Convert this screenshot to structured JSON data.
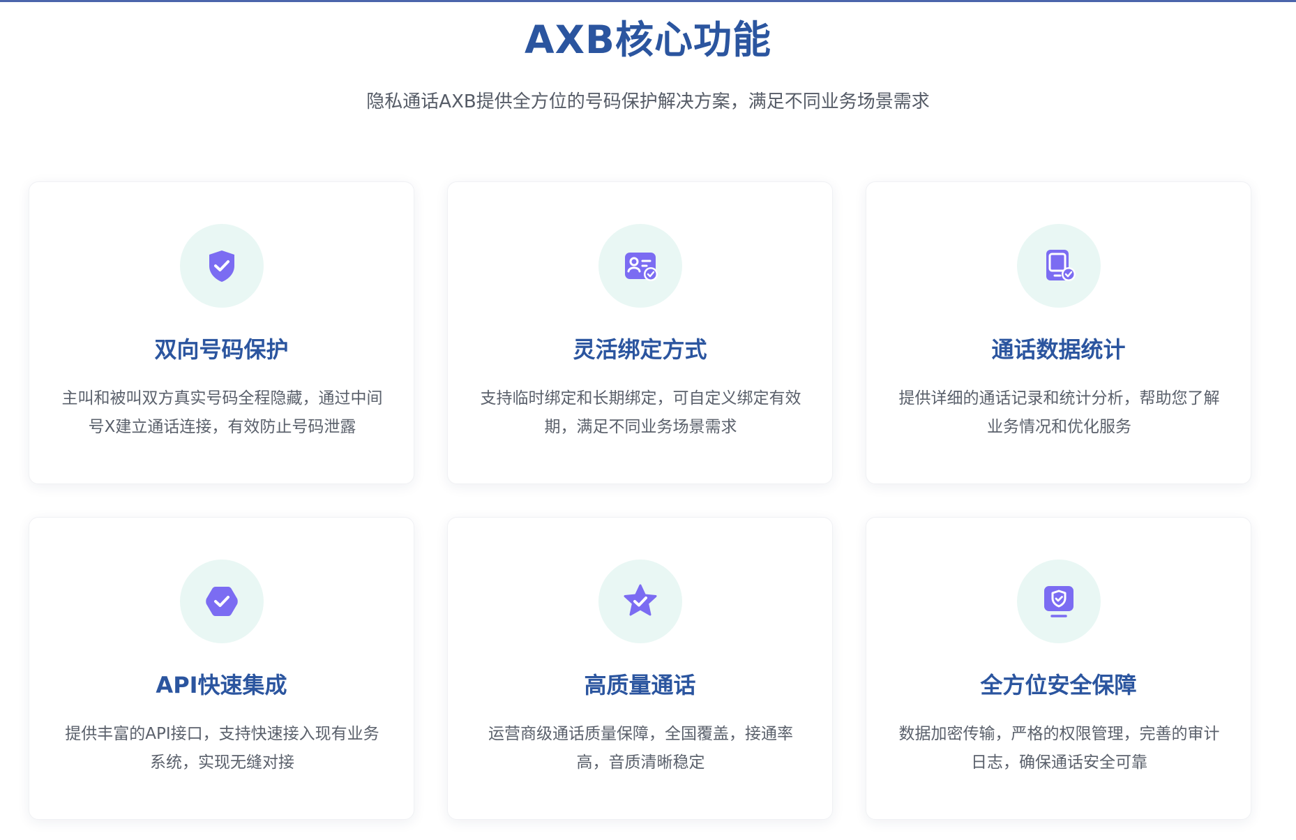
{
  "section": {
    "title": "AXB核心功能",
    "subtitle": "隐私通话AXB提供全方位的号码保护解决方案，满足不同业务场景需求"
  },
  "colors": {
    "accent": "#2b559f",
    "icon": "#7b6cf2",
    "icon_bg": "#e9f7f4"
  },
  "features": [
    {
      "icon": "shield-check-icon",
      "title": "双向号码保护",
      "description": "主叫和被叫双方真实号码全程隐藏，通过中间号X建立通话连接，有效防止号码泄露"
    },
    {
      "icon": "contact-card-check-icon",
      "title": "灵活绑定方式",
      "description": "支持临时绑定和长期绑定，可自定义绑定有效期，满足不同业务场景需求"
    },
    {
      "icon": "tablet-check-icon",
      "title": "通话数据统计",
      "description": "提供详细的通话记录和统计分析，帮助您了解业务情况和优化服务"
    },
    {
      "icon": "badge-check-icon",
      "title": "API快速集成",
      "description": "提供丰富的API接口，支持快速接入现有业务系统，实现无缝对接"
    },
    {
      "icon": "star-check-icon",
      "title": "高质量通话",
      "description": "运营商级通话质量保障，全国覆盖，接通率高，音质清晰稳定"
    },
    {
      "icon": "monitor-shield-icon",
      "title": "全方位安全保障",
      "description": "数据加密传输，严格的权限管理，完善的审计日志，确保通话安全可靠"
    }
  ]
}
